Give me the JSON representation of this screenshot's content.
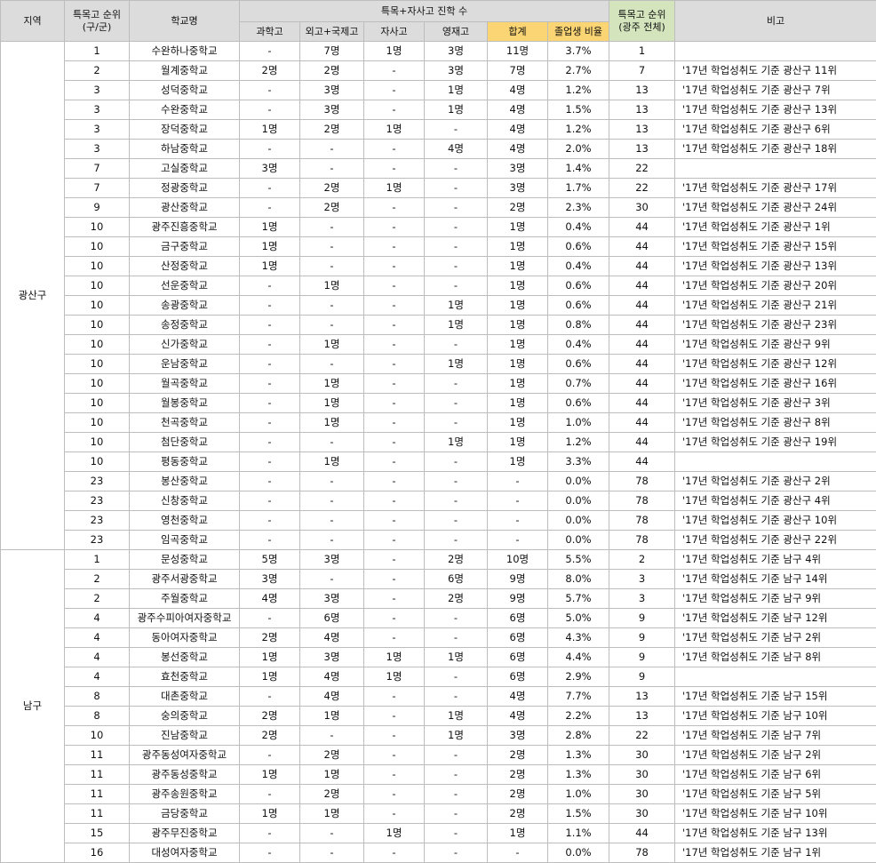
{
  "headers": {
    "region": "지역",
    "rank_gu": "특목고 순위\n(구/군)",
    "school": "학교명",
    "group": "특목+자사고 진학 수",
    "science": "과학고",
    "foreign": "외고+국제고",
    "private": "자사고",
    "gifted": "영재고",
    "total": "합계",
    "ratio": "졸업생 비율",
    "rank_all": "특목고 순위\n(광주 전체)",
    "note": "비고"
  },
  "groups": [
    {
      "region": "광산구",
      "rows": [
        [
          "1",
          "수완하나중학교",
          "-",
          "7명",
          "1명",
          "3명",
          "11명",
          "3.7%",
          "1",
          ""
        ],
        [
          "2",
          "월계중학교",
          "2명",
          "2명",
          "-",
          "3명",
          "7명",
          "2.7%",
          "7",
          "'17년 학업성취도 기준 광산구 11위"
        ],
        [
          "3",
          "성덕중학교",
          "-",
          "3명",
          "-",
          "1명",
          "4명",
          "1.2%",
          "13",
          "'17년 학업성취도 기준 광산구 7위"
        ],
        [
          "3",
          "수완중학교",
          "-",
          "3명",
          "-",
          "1명",
          "4명",
          "1.5%",
          "13",
          "'17년 학업성취도 기준 광산구 13위"
        ],
        [
          "3",
          "장덕중학교",
          "1명",
          "2명",
          "1명",
          "-",
          "4명",
          "1.2%",
          "13",
          "'17년 학업성취도 기준 광산구 6위"
        ],
        [
          "3",
          "하남중학교",
          "-",
          "-",
          "-",
          "4명",
          "4명",
          "2.0%",
          "13",
          "'17년 학업성취도 기준 광산구 18위"
        ],
        [
          "7",
          "고실중학교",
          "3명",
          "-",
          "-",
          "-",
          "3명",
          "1.4%",
          "22",
          ""
        ],
        [
          "7",
          "정광중학교",
          "-",
          "2명",
          "1명",
          "-",
          "3명",
          "1.7%",
          "22",
          "'17년 학업성취도 기준 광산구 17위"
        ],
        [
          "9",
          "광산중학교",
          "-",
          "2명",
          "-",
          "-",
          "2명",
          "2.3%",
          "30",
          "'17년 학업성취도 기준 광산구 24위"
        ],
        [
          "10",
          "광주진흥중학교",
          "1명",
          "-",
          "-",
          "-",
          "1명",
          "0.4%",
          "44",
          "'17년 학업성취도 기준 광산구 1위"
        ],
        [
          "10",
          "금구중학교",
          "1명",
          "-",
          "-",
          "-",
          "1명",
          "0.6%",
          "44",
          "'17년 학업성취도 기준 광산구 15위"
        ],
        [
          "10",
          "산정중학교",
          "1명",
          "-",
          "-",
          "-",
          "1명",
          "0.4%",
          "44",
          "'17년 학업성취도 기준 광산구 13위"
        ],
        [
          "10",
          "선운중학교",
          "-",
          "1명",
          "-",
          "-",
          "1명",
          "0.6%",
          "44",
          "'17년 학업성취도 기준 광산구 20위"
        ],
        [
          "10",
          "송광중학교",
          "-",
          "-",
          "-",
          "1명",
          "1명",
          "0.6%",
          "44",
          "'17년 학업성취도 기준 광산구 21위"
        ],
        [
          "10",
          "송정중학교",
          "-",
          "-",
          "-",
          "1명",
          "1명",
          "0.8%",
          "44",
          "'17년 학업성취도 기준 광산구 23위"
        ],
        [
          "10",
          "신가중학교",
          "-",
          "1명",
          "-",
          "-",
          "1명",
          "0.4%",
          "44",
          "'17년 학업성취도 기준 광산구 9위"
        ],
        [
          "10",
          "운남중학교",
          "-",
          "-",
          "-",
          "1명",
          "1명",
          "0.6%",
          "44",
          "'17년 학업성취도 기준 광산구 12위"
        ],
        [
          "10",
          "월곡중학교",
          "-",
          "1명",
          "-",
          "-",
          "1명",
          "0.7%",
          "44",
          "'17년 학업성취도 기준 광산구 16위"
        ],
        [
          "10",
          "월봉중학교",
          "-",
          "1명",
          "-",
          "-",
          "1명",
          "0.6%",
          "44",
          "'17년 학업성취도 기준 광산구 3위"
        ],
        [
          "10",
          "천곡중학교",
          "-",
          "1명",
          "-",
          "-",
          "1명",
          "1.0%",
          "44",
          "'17년 학업성취도 기준 광산구 8위"
        ],
        [
          "10",
          "첨단중학교",
          "-",
          "-",
          "-",
          "1명",
          "1명",
          "1.2%",
          "44",
          "'17년 학업성취도 기준 광산구 19위"
        ],
        [
          "10",
          "평동중학교",
          "-",
          "1명",
          "-",
          "-",
          "1명",
          "3.3%",
          "44",
          ""
        ],
        [
          "23",
          "봉산중학교",
          "-",
          "-",
          "-",
          "-",
          "-",
          "0.0%",
          "78",
          "'17년 학업성취도 기준 광산구 2위"
        ],
        [
          "23",
          "신창중학교",
          "-",
          "-",
          "-",
          "-",
          "-",
          "0.0%",
          "78",
          "'17년 학업성취도 기준 광산구 4위"
        ],
        [
          "23",
          "영천중학교",
          "-",
          "-",
          "-",
          "-",
          "-",
          "0.0%",
          "78",
          "'17년 학업성취도 기준 광산구 10위"
        ],
        [
          "23",
          "임곡중학교",
          "-",
          "-",
          "-",
          "-",
          "-",
          "0.0%",
          "78",
          "'17년 학업성취도 기준 광산구 22위"
        ]
      ]
    },
    {
      "region": "남구",
      "rows": [
        [
          "1",
          "문성중학교",
          "5명",
          "3명",
          "-",
          "2명",
          "10명",
          "5.5%",
          "2",
          "'17년 학업성취도 기준 남구 4위"
        ],
        [
          "2",
          "광주서광중학교",
          "3명",
          "-",
          "-",
          "6명",
          "9명",
          "8.0%",
          "3",
          "'17년 학업성취도 기준 남구 14위"
        ],
        [
          "2",
          "주월중학교",
          "4명",
          "3명",
          "-",
          "2명",
          "9명",
          "5.7%",
          "3",
          "'17년 학업성취도 기준 남구 9위"
        ],
        [
          "4",
          "광주수피아여자중학교",
          "-",
          "6명",
          "-",
          "-",
          "6명",
          "5.0%",
          "9",
          "'17년 학업성취도 기준 남구 12위"
        ],
        [
          "4",
          "동아여자중학교",
          "2명",
          "4명",
          "-",
          "-",
          "6명",
          "4.3%",
          "9",
          "'17년 학업성취도 기준 남구 2위"
        ],
        [
          "4",
          "봉선중학교",
          "1명",
          "3명",
          "1명",
          "1명",
          "6명",
          "4.4%",
          "9",
          "'17년 학업성취도 기준 남구 8위"
        ],
        [
          "4",
          "효천중학교",
          "1명",
          "4명",
          "1명",
          "-",
          "6명",
          "2.9%",
          "9",
          ""
        ],
        [
          "8",
          "대촌중학교",
          "-",
          "4명",
          "-",
          "-",
          "4명",
          "7.7%",
          "13",
          "'17년 학업성취도 기준 남구 15위"
        ],
        [
          "8",
          "숭의중학교",
          "2명",
          "1명",
          "-",
          "1명",
          "4명",
          "2.2%",
          "13",
          "'17년 학업성취도 기준 남구 10위"
        ],
        [
          "10",
          "진남중학교",
          "2명",
          "-",
          "-",
          "1명",
          "3명",
          "2.8%",
          "22",
          "'17년 학업성취도 기준 남구 7위"
        ],
        [
          "11",
          "광주동성여자중학교",
          "-",
          "2명",
          "-",
          "-",
          "2명",
          "1.3%",
          "30",
          "'17년 학업성취도 기준 남구 2위"
        ],
        [
          "11",
          "광주동성중학교",
          "1명",
          "1명",
          "-",
          "-",
          "2명",
          "1.3%",
          "30",
          "'17년 학업성취도 기준 남구 6위"
        ],
        [
          "11",
          "광주송원중학교",
          "-",
          "2명",
          "-",
          "-",
          "2명",
          "1.0%",
          "30",
          "'17년 학업성취도 기준 남구 5위"
        ],
        [
          "11",
          "금당중학교",
          "1명",
          "1명",
          "-",
          "-",
          "2명",
          "1.5%",
          "30",
          "'17년 학업성취도 기준 남구 10위"
        ],
        [
          "15",
          "광주무진중학교",
          "-",
          "-",
          "1명",
          "-",
          "1명",
          "1.1%",
          "44",
          "'17년 학업성취도 기준 남구 13위"
        ],
        [
          "16",
          "대성여자중학교",
          "-",
          "-",
          "-",
          "-",
          "-",
          "0.0%",
          "78",
          "'17년 학업성취도 기준 남구 1위"
        ]
      ]
    }
  ]
}
